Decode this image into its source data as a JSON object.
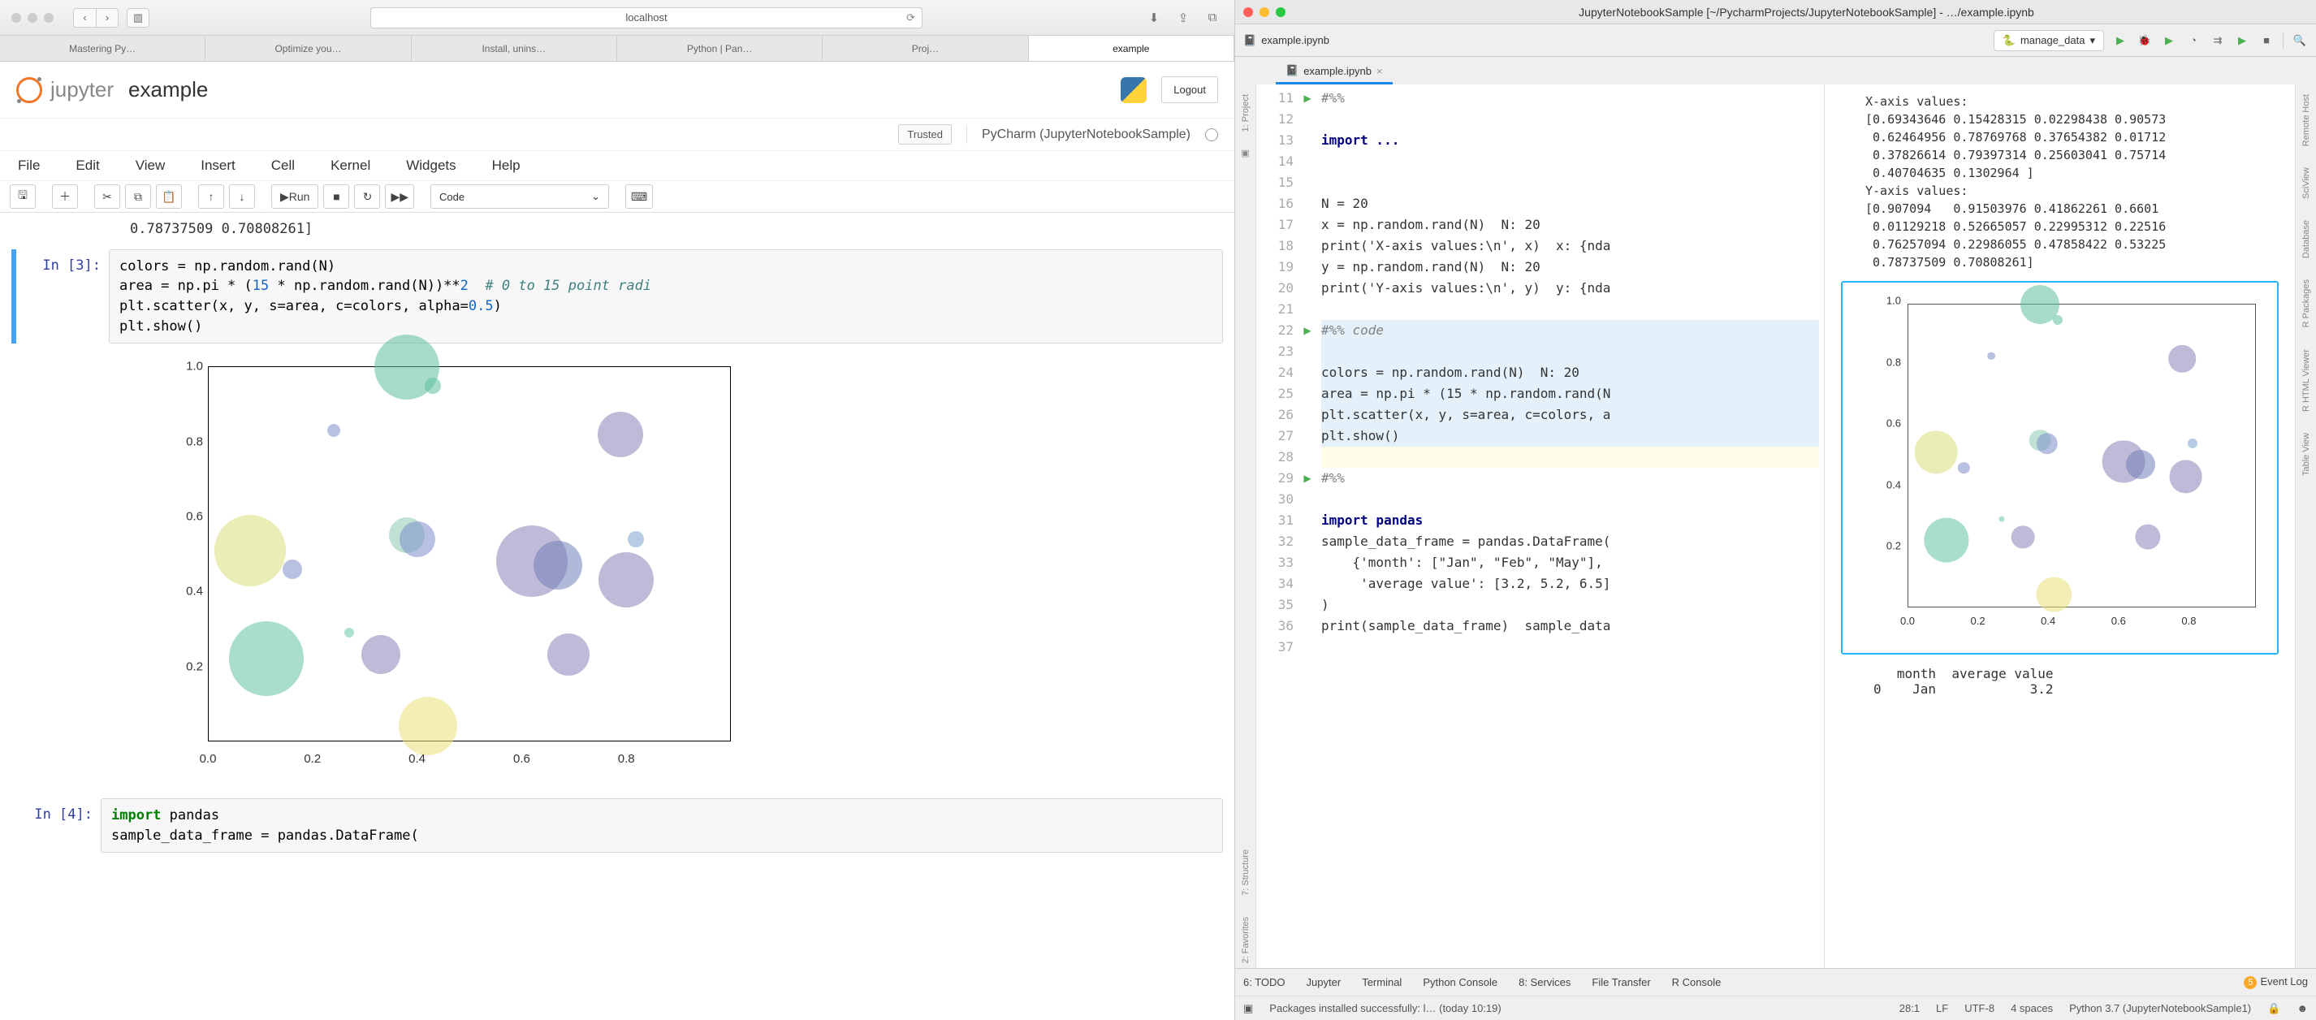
{
  "safari": {
    "address": "localhost",
    "tabs": [
      "Mastering Py…",
      "Optimize you…",
      "Install, unins…",
      "Python | Pan…",
      "Proj…",
      "example"
    ],
    "active_tab": 5
  },
  "jupyter": {
    "brand": "jupyter",
    "title": "example",
    "logout": "Logout",
    "trusted": "Trusted",
    "kernel": "PyCharm (JupyterNotebookSample)",
    "menus": [
      "File",
      "Edit",
      "View",
      "Insert",
      "Cell",
      "Kernel",
      "Widgets",
      "Help"
    ],
    "run_label": "Run",
    "cell_type": "Code",
    "prev_output": "0.78737509 0.70808261]",
    "in3_prompt": "In [3]:",
    "in3_code": "colors = np.random.rand(N)\narea = np.pi * (15 * np.random.rand(N))**2  # 0 to 15 point radi…\nplt.scatter(x, y, s=area, c=colors, alpha=0.5)\nplt.show()",
    "in4_prompt": "In [4]:",
    "in4_code": "import pandas\nsample_data_frame = pandas.DataFrame("
  },
  "chart_data": {
    "type": "scatter",
    "xlim": [
      0.0,
      1.0
    ],
    "ylim": [
      0.0,
      1.0
    ],
    "xticks": [
      0.0,
      0.2,
      0.4,
      0.6,
      0.8
    ],
    "yticks": [
      0.2,
      0.4,
      0.6,
      0.8,
      1.0
    ],
    "points": [
      {
        "x": 0.08,
        "y": 0.51,
        "r": 44,
        "c": "#d9e07a"
      },
      {
        "x": 0.11,
        "y": 0.22,
        "r": 46,
        "c": "#61c3a1"
      },
      {
        "x": 0.16,
        "y": 0.46,
        "r": 12,
        "c": "#7e8ecb"
      },
      {
        "x": 0.24,
        "y": 0.83,
        "r": 8,
        "c": "#7e8ecb"
      },
      {
        "x": 0.27,
        "y": 0.29,
        "r": 6,
        "c": "#6cc6a6"
      },
      {
        "x": 0.38,
        "y": 1.0,
        "r": 40,
        "c": "#5ec0a2"
      },
      {
        "x": 0.38,
        "y": 0.55,
        "r": 22,
        "c": "#8bcab1"
      },
      {
        "x": 0.4,
        "y": 0.54,
        "r": 22,
        "c": "#7e8ecb"
      },
      {
        "x": 0.42,
        "y": 0.04,
        "r": 36,
        "c": "#e8e07a"
      },
      {
        "x": 0.43,
        "y": 0.95,
        "r": 10,
        "c": "#5ec0a2"
      },
      {
        "x": 0.33,
        "y": 0.23,
        "r": 24,
        "c": "#8d7fb6"
      },
      {
        "x": 0.62,
        "y": 0.48,
        "r": 44,
        "c": "#8d7fb6"
      },
      {
        "x": 0.67,
        "y": 0.47,
        "r": 30,
        "c": "#6f7fb8"
      },
      {
        "x": 0.69,
        "y": 0.23,
        "r": 26,
        "c": "#8d7fb6"
      },
      {
        "x": 0.8,
        "y": 0.43,
        "r": 34,
        "c": "#8d7fb6"
      },
      {
        "x": 0.79,
        "y": 0.82,
        "r": 28,
        "c": "#8d7fb6"
      },
      {
        "x": 0.82,
        "y": 0.54,
        "r": 10,
        "c": "#7aa3cf"
      }
    ]
  },
  "ide": {
    "window_title": "JupyterNotebookSample [~/PycharmProjects/JupyterNotebookSample] - …/example.ipynb",
    "file_tab": "example.ipynb",
    "run_config": "manage_data",
    "left_rails": [
      "1: Project"
    ],
    "left_rails2": [
      "7: Structure",
      "2: Favorites"
    ],
    "right_rails": [
      "Remote Host",
      "SciView",
      "Database",
      "R Packages",
      "R HTML Viewer",
      "Table View"
    ],
    "lines": [
      {
        "n": 11,
        "run": true,
        "t": "#%%",
        "cls": "pycom"
      },
      {
        "n": 12,
        "t": ""
      },
      {
        "n": 13,
        "t": "import ...",
        "cls": "pyk2"
      },
      {
        "n": 14,
        "t": ""
      },
      {
        "n": 15,
        "t": ""
      },
      {
        "n": 16,
        "t": "N = 20"
      },
      {
        "n": 17,
        "t": "x = np.random.rand(N)  N: 20"
      },
      {
        "n": 18,
        "t": "print('X-axis values:\\n', x)  x: {nda"
      },
      {
        "n": 19,
        "t": "y = np.random.rand(N)  N: 20"
      },
      {
        "n": 20,
        "t": "print('Y-axis values:\\n', y)  y: {nda"
      },
      {
        "n": 21,
        "t": ""
      },
      {
        "n": 22,
        "run": true,
        "t": "#%% code",
        "cls": "pycom",
        "hl": true
      },
      {
        "n": 23,
        "t": "",
        "hl": true
      },
      {
        "n": 24,
        "t": "colors = np.random.rand(N)  N: 20",
        "hl": true
      },
      {
        "n": 25,
        "t": "area = np.pi * (15 * np.random.rand(N",
        "hl": true
      },
      {
        "n": 26,
        "t": "plt.scatter(x, y, s=area, c=colors, a",
        "hl": true
      },
      {
        "n": 27,
        "t": "plt.show()",
        "hl": true
      },
      {
        "n": 28,
        "t": "",
        "cur": true
      },
      {
        "n": 29,
        "run": true,
        "t": "#%%",
        "cls": "pycom"
      },
      {
        "n": 30,
        "t": ""
      },
      {
        "n": 31,
        "t": "import pandas",
        "cls": "pyk2"
      },
      {
        "n": 32,
        "t": "sample_data_frame = pandas.DataFrame("
      },
      {
        "n": 33,
        "t": "    {'month': [\"Jan\", \"Feb\", \"May\"],"
      },
      {
        "n": 34,
        "t": "     'average value': [3.2, 5.2, 6.5]"
      },
      {
        "n": 35,
        "t": ")"
      },
      {
        "n": 36,
        "t": "print(sample_data_frame)  sample_data"
      },
      {
        "n": 37,
        "t": ""
      }
    ],
    "output_x_label": "X-axis values:",
    "output_x": "[0.69343646 0.15428315 0.02298438 0.90573\n 0.62464956 0.78769768 0.37654382 0.01712\n 0.37826614 0.79397314 0.25603041 0.75714\n 0.40704635 0.1302964 ]",
    "output_y_label": "Y-axis values:",
    "output_y": "[0.907094   0.91503976 0.41862261 0.6601\n 0.01129218 0.52665057 0.22995312 0.22516\n 0.76257094 0.22986055 0.47858422 0.53225\n 0.78737509 0.70808261]",
    "df_header": "   month  average value",
    "df_row0": "0    Jan            3.2",
    "bottom": [
      "6: TODO",
      "Jupyter",
      "Terminal",
      "Python Console",
      "8: Services",
      "File Transfer",
      "R Console"
    ],
    "event_log": "Event Log",
    "event_badge": "5",
    "status_msg": "Packages installed successfully: l… (today 10:19)",
    "status_pos": "28:1",
    "status_lf": "LF",
    "status_enc": "UTF-8",
    "status_indent": "4 spaces",
    "status_py": "Python 3.7 (JupyterNotebookSample1)"
  }
}
